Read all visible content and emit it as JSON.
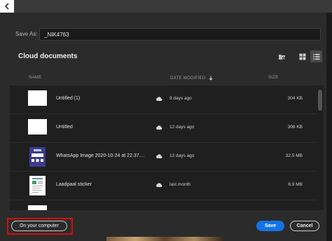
{
  "dialog": {
    "save_as_label": "Save As:",
    "filename": "_NIK4763",
    "section_title": "Cloud documents"
  },
  "columns": {
    "name": "NAME",
    "date_modified": "DATE MODIFIED",
    "size": "SIZE"
  },
  "files": [
    {
      "name": "Untitled (1)",
      "date": "9 days ago",
      "size": "304 KB",
      "thumb": "blank"
    },
    {
      "name": "Untitled",
      "date": "12 days ago",
      "size": "308 KB",
      "thumb": "blank"
    },
    {
      "name": "WhatsApp Image 2020-10-24 at 22.37....",
      "date": "12 days ago",
      "size": "32.5 MB",
      "thumb": "whatsapp"
    },
    {
      "name": "Laadpaal sticker",
      "date": "last month",
      "size": "6.9 MB",
      "thumb": "document"
    },
    {
      "name": "",
      "date": "",
      "size": "",
      "thumb": "blank"
    }
  ],
  "buttons": {
    "on_your_computer": "On your computer",
    "save": "Save",
    "cancel": "Cancel"
  },
  "colors": {
    "accent": "#1473e6",
    "highlight": "#d10f0f",
    "background": "#2b2b2b"
  }
}
